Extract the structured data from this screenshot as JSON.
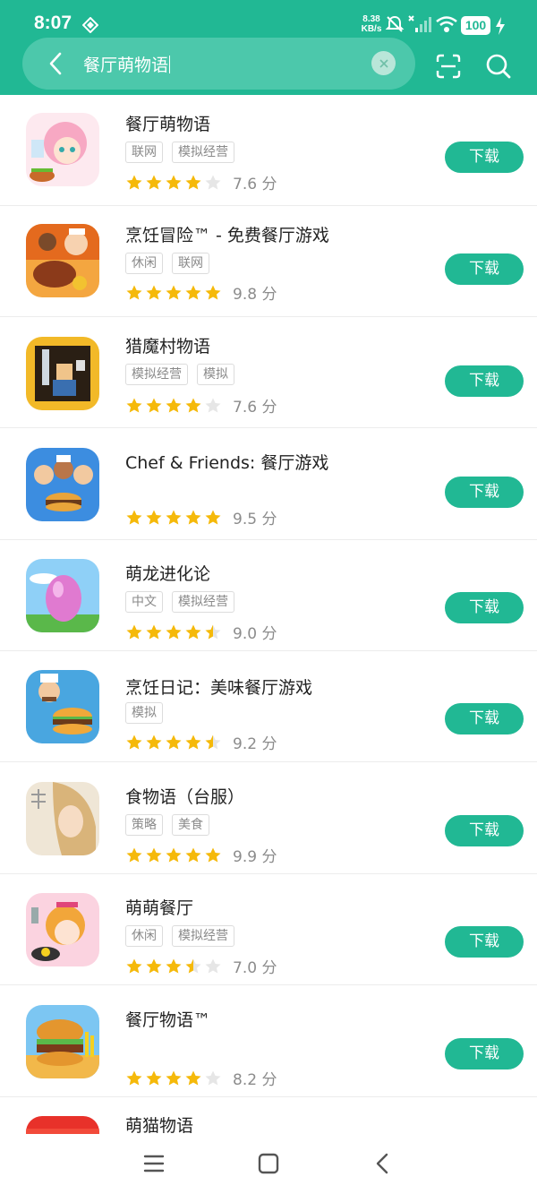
{
  "status_bar": {
    "time": "8:07",
    "net_speed_value": "8.38",
    "net_speed_unit": "KB/s",
    "battery": "100"
  },
  "search": {
    "query": "餐厅萌物语"
  },
  "colors": {
    "accent": "#21b894",
    "star_filled": "#f5b90a",
    "star_empty": "#e6e6e6"
  },
  "download_label": "下载",
  "apps": [
    {
      "title": "餐厅萌物语",
      "tags": [
        "联网",
        "模拟经营"
      ],
      "rating_stars": 4,
      "score": "7.6 分",
      "icon": "anime-chef-girl-icon"
    },
    {
      "title": "烹饪冒险™ - 免费餐厅游戏",
      "tags": [
        "休闲",
        "联网"
      ],
      "rating_stars": 5,
      "score": "9.8 分",
      "icon": "steak-chef-icon"
    },
    {
      "title": "猎魔村物语",
      "tags": [
        "模拟经营",
        "模拟"
      ],
      "rating_stars": 4,
      "score": "7.6 分",
      "icon": "pixel-warrior-icon"
    },
    {
      "title": "Chef & Friends: 餐厅游戏",
      "tags": [],
      "rating_stars": 5,
      "score": "9.5 分",
      "icon": "burger-friends-icon"
    },
    {
      "title": "萌龙进化论",
      "tags": [
        "中文",
        "模拟经营"
      ],
      "rating_stars": 4.5,
      "score": "9.0 分",
      "icon": "dragon-egg-icon"
    },
    {
      "title": "烹饪日记：美味餐厅游戏",
      "tags": [
        "模拟"
      ],
      "rating_stars": 4.5,
      "score": "9.2 分",
      "icon": "chef-burger-icon"
    },
    {
      "title": "食物语（台服）",
      "tags": [
        "策略",
        "美食"
      ],
      "rating_stars": 5,
      "score": "9.9 分",
      "icon": "anime-character-icon"
    },
    {
      "title": "萌萌餐厅",
      "tags": [
        "休闲",
        "模拟经营"
      ],
      "rating_stars": 3.5,
      "score": "7.0 分",
      "icon": "cook-girl-icon"
    },
    {
      "title": "餐厅物语™",
      "tags": [],
      "rating_stars": 4,
      "score": "8.2 分",
      "icon": "burger-fries-icon"
    },
    {
      "title": "萌猫物语",
      "tags": [],
      "rating_stars": 0,
      "score": "",
      "icon": "cat-app-icon"
    }
  ]
}
